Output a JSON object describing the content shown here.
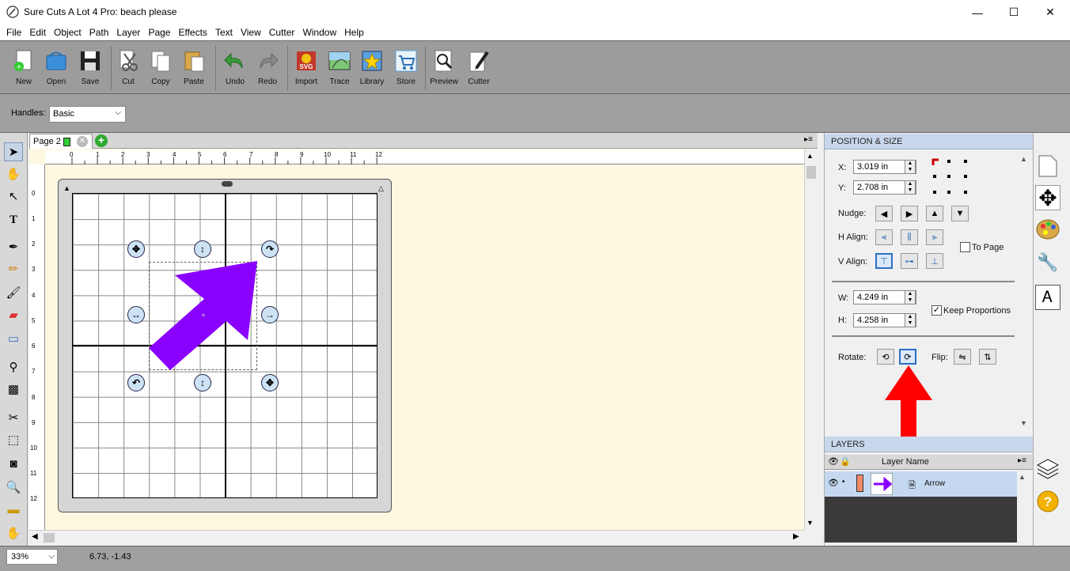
{
  "window": {
    "title": "Sure Cuts A Lot 4 Pro: beach please",
    "minimize": "—",
    "maximize": "☐",
    "close": "✕"
  },
  "menu": [
    "File",
    "Edit",
    "Object",
    "Path",
    "Layer",
    "Page",
    "Effects",
    "Text",
    "View",
    "Cutter",
    "Window",
    "Help"
  ],
  "toolbar": {
    "new": "New",
    "open": "Open",
    "save": "Save",
    "cut": "Cut",
    "copy": "Copy",
    "paste": "Paste",
    "undo": "Undo",
    "redo": "Redo",
    "import": "Import",
    "trace": "Trace",
    "library": "Library",
    "store": "Store",
    "preview": "Preview",
    "cutter": "Cutter"
  },
  "handles": {
    "label": "Handles:",
    "value": "Basic"
  },
  "page_tab": {
    "label": "Page 2"
  },
  "ruler": {
    "top": [
      "0",
      "1",
      "2",
      "3",
      "4",
      "5",
      "6",
      "7",
      "8",
      "9",
      "10",
      "11",
      "12"
    ],
    "left": [
      "0",
      "1",
      "2",
      "3",
      "4",
      "5",
      "6",
      "7",
      "8",
      "9",
      "10",
      "11",
      "12"
    ]
  },
  "status": {
    "zoom": "33%",
    "coords": "6.73, -1.43"
  },
  "position_size": {
    "header": "POSITION & SIZE",
    "x_label": "X:",
    "x_value": "3.019 in",
    "y_label": "Y:",
    "y_value": "2.708 in",
    "nudge_label": "Nudge:",
    "halign_label": "H Align:",
    "valign_label": "V Align:",
    "to_page_label": "To Page",
    "w_label": "W:",
    "w_value": "4.249 in",
    "h_label": "H:",
    "h_value": "4.258 in",
    "keep_proportions_label": "Keep Proportions",
    "rotate_label": "Rotate:",
    "flip_label": "Flip:"
  },
  "layers": {
    "header": "LAYERS",
    "column": "Layer Name",
    "rows": [
      {
        "name": "Arrow"
      }
    ]
  },
  "colors": {
    "arrow": "#8a00ff",
    "red_annotation": "#ff0000",
    "panel_header": "#c9d7ec"
  }
}
